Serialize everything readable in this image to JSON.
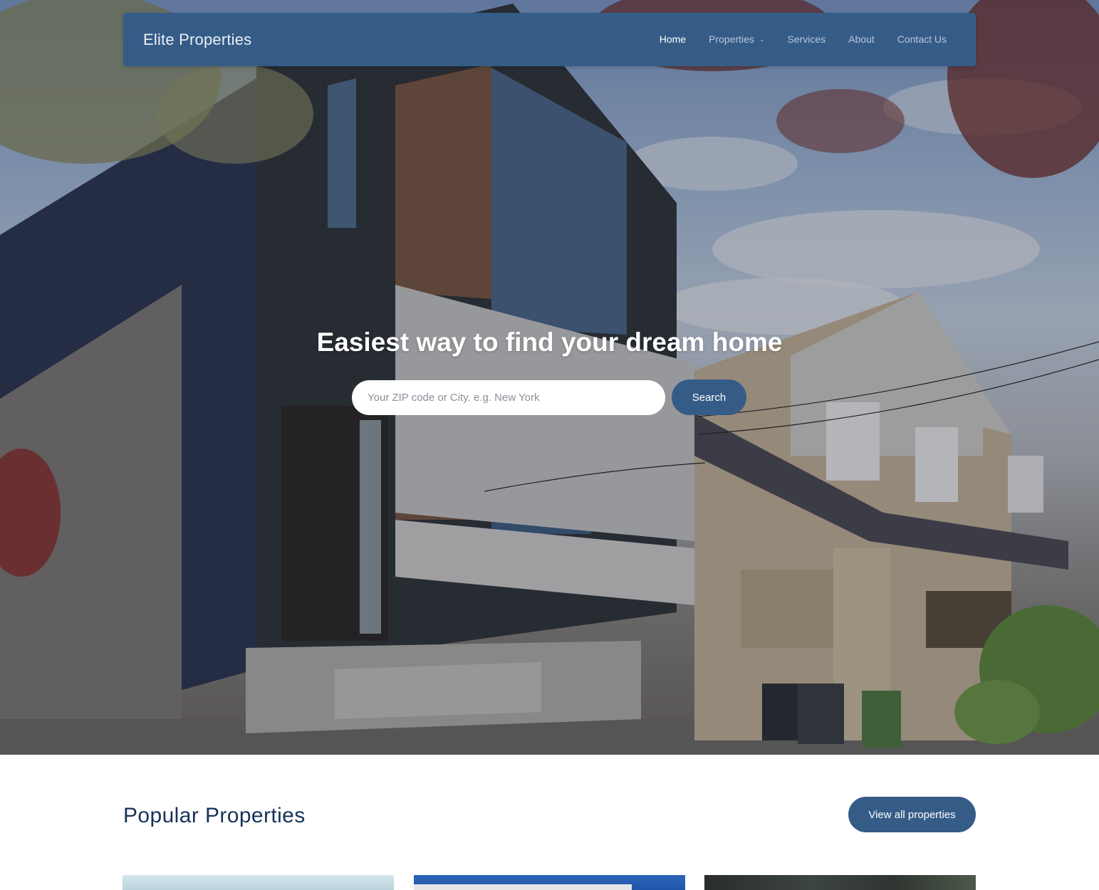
{
  "brand": "Elite Properties",
  "nav": {
    "items": [
      {
        "label": "Home",
        "active": true
      },
      {
        "label": "Properties",
        "active": false,
        "dropdown": true,
        "icon": "chevron-down-icon"
      },
      {
        "label": "Services",
        "active": false
      },
      {
        "label": "About",
        "active": false
      },
      {
        "label": "Contact Us",
        "active": false
      }
    ]
  },
  "hero": {
    "title": "Easiest way to find your dream home",
    "search": {
      "placeholder": "Your ZIP code or City. e.g. New York",
      "value": "",
      "button_label": "Search"
    }
  },
  "popular": {
    "title": "Popular Properties",
    "view_all_label": "View all properties"
  },
  "colors": {
    "primary": "#355c87",
    "heading": "#17325a",
    "white": "#ffffff"
  }
}
